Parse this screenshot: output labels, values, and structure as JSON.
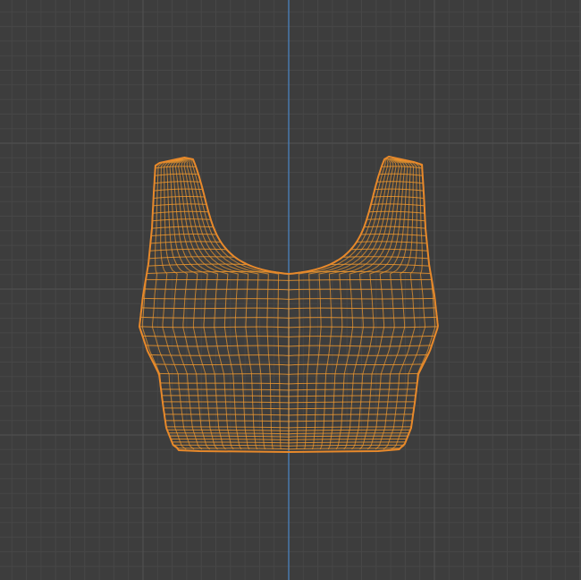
{
  "viewport": {
    "mode": "wireframe-orthographic-front",
    "background_color": "#3d3d3d",
    "minor_grid_color": "#474747",
    "major_grid_color": "#525252",
    "vertical_axis_color": "#4a87c8",
    "show_grid": true
  },
  "mesh": {
    "object_type": "crop-top",
    "wire_color": "#f0992e",
    "outline_color": "#e8892a",
    "selected": true
  }
}
